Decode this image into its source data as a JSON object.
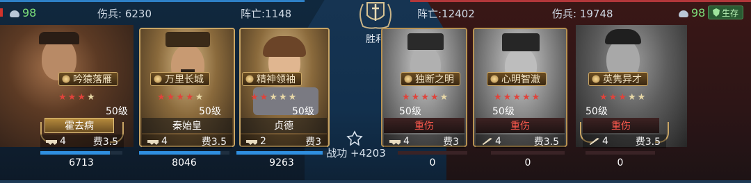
{
  "left": {
    "power_icon": "fist-icon",
    "power": "98",
    "wounded_label": "伤兵: 6230",
    "killed_label": "阵亡:1148"
  },
  "right": {
    "killed_label": "阵亡:12402",
    "wounded_label": "伤兵: 19748",
    "power": "98",
    "status": "生存"
  },
  "center": {
    "result": "胜利",
    "merit": "战功 +4203"
  },
  "left_generals": [
    {
      "skill": "吟猿落雁",
      "stars": 3,
      "max_stars": 4,
      "level": "50级",
      "name": "霍去病",
      "troop_icon": "chariot-icon",
      "troop_count": "4",
      "cost": "费3.5",
      "hp": "6713",
      "hp_fraction": 0.85
    },
    {
      "skill": "万里长城",
      "stars": 4,
      "max_stars": 5,
      "level": "50级",
      "name": "秦始皇",
      "troop_icon": "chariot-icon",
      "troop_count": "4",
      "cost": "费3.5",
      "hp": "8046",
      "hp_fraction": 0.9
    },
    {
      "skill": "精神领袖",
      "stars": 2,
      "max_stars": 5,
      "level": "50级",
      "name": "贞德",
      "troop_icon": "chariot-icon",
      "troop_count": "2",
      "cost": "费3",
      "hp": "9263",
      "hp_fraction": 0.95
    }
  ],
  "right_generals": [
    {
      "skill": "独断之明",
      "stars": 4,
      "max_stars": 5,
      "level": "50级",
      "status": "重伤",
      "troop_icon": "chariot-icon",
      "troop_count": "4",
      "cost": "费3",
      "hp": "0",
      "hp_fraction": 0.0
    },
    {
      "skill": "心明智澈",
      "stars": 5,
      "max_stars": 5,
      "level": "50级",
      "status": "重伤",
      "troop_icon": "sword-icon",
      "troop_count": "4",
      "cost": "费3.5",
      "hp": "0",
      "hp_fraction": 0.0
    },
    {
      "skill": "英隽异才",
      "stars": 3,
      "max_stars": 5,
      "level": "50级",
      "status": "重伤",
      "troop_icon": "sword-icon",
      "troop_count": "4",
      "cost": "费3.5",
      "hp": "0",
      "hp_fraction": 0.0
    }
  ],
  "colors": {
    "left_accent": "#2e80c6",
    "right_accent": "#b2373a",
    "power_green": "#7de07a",
    "injured_red": "#ff5a4e",
    "star_red": "#e0433b"
  }
}
